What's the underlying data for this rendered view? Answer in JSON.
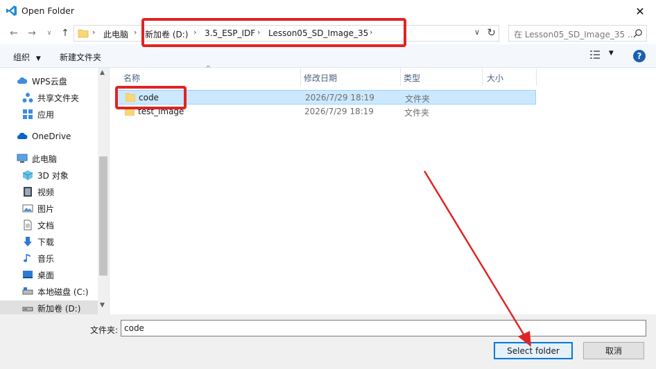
{
  "window": {
    "title": "Open Folder"
  },
  "address": {
    "crumbs": [
      "此电脑",
      "新加卷 (D:)",
      "3.5_ESP_IDF",
      "Lesson05_SD_Image_35"
    ],
    "search_placeholder": "在 Lesson05_SD_Image_35 ..."
  },
  "toolbar": {
    "organize": "组织",
    "new_folder": "新建文件夹"
  },
  "sidebar": {
    "items": [
      {
        "label": "WPS云盘",
        "icon": "cloud-icon"
      },
      {
        "label": "共享文件夹",
        "icon": "share-icon"
      },
      {
        "label": "应用",
        "icon": "apps-icon"
      },
      {
        "label": "OneDrive",
        "icon": "onedrive-icon"
      },
      {
        "label": "此电脑",
        "icon": "computer-icon"
      },
      {
        "label": "3D 对象",
        "icon": "cube-icon"
      },
      {
        "label": "视频",
        "icon": "video-icon"
      },
      {
        "label": "图片",
        "icon": "pictures-icon"
      },
      {
        "label": "文档",
        "icon": "document-icon"
      },
      {
        "label": "下载",
        "icon": "download-icon"
      },
      {
        "label": "音乐",
        "icon": "music-icon"
      },
      {
        "label": "桌面",
        "icon": "desktop-icon"
      },
      {
        "label": "本地磁盘 (C:)",
        "icon": "drive-icon"
      },
      {
        "label": "新加卷 (D:)",
        "icon": "drive-icon"
      }
    ]
  },
  "columns": {
    "name": "名称",
    "date": "修改日期",
    "type": "类型",
    "size": "大小"
  },
  "files": [
    {
      "name": "code",
      "date": "2026/7/29 18:19",
      "type": "文件夹"
    },
    {
      "name": "test_image",
      "date": "2026/7/29 18:19",
      "type": "文件夹"
    }
  ],
  "footer": {
    "folder_label": "文件夹:",
    "folder_value": "code",
    "select_button": "Select folder",
    "cancel_button": "取消"
  },
  "colors": {
    "annotation": "#e02424",
    "selection": "#cce8ff",
    "accent": "#0078d7"
  }
}
